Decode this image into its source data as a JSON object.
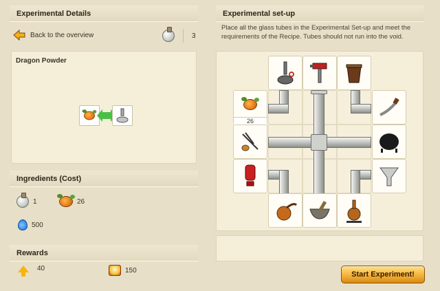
{
  "details": {
    "title": "Experimental Details",
    "back_label": "Back to the overview",
    "potion_count": "3"
  },
  "recipe": {
    "name": "Dragon Powder"
  },
  "ingredients": {
    "title": "Ingredients (Cost)",
    "items": [
      {
        "icon": "potion-icon",
        "value": "1"
      },
      {
        "icon": "pumpkin-icon",
        "value": "26"
      },
      {
        "icon": "water-drop-icon",
        "value": "500"
      }
    ]
  },
  "rewards": {
    "title": "Rewards",
    "items": [
      {
        "icon": "up-arrow-icon",
        "value": "40"
      },
      {
        "icon": "reward-badge-icon",
        "value": "150"
      }
    ]
  },
  "setup": {
    "title": "Experimental set-up",
    "instructions": "Place all the glass tubes in the Experimental Set-up and meet the requirements of the Recipe. Tubes should not run into the void.",
    "pumpkin_count": "26"
  },
  "start_button": "Start Experiment!",
  "colors": {
    "background": "#e8dfc8",
    "accent": "#f4b33a",
    "green_arrow": "#48c046"
  }
}
